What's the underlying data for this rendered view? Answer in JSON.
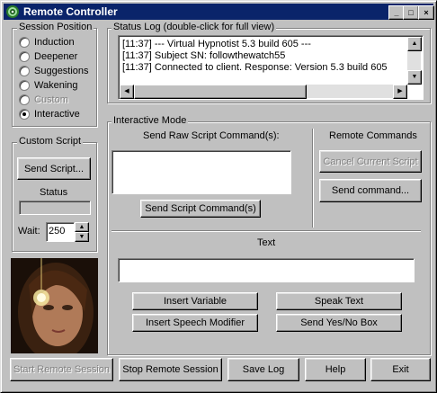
{
  "window": {
    "title": "Remote Controller",
    "controls": [
      "_",
      "□",
      "×"
    ]
  },
  "session_position": {
    "label": "Session Position",
    "options": [
      {
        "label": "Induction",
        "checked": false,
        "enabled": true
      },
      {
        "label": "Deepener",
        "checked": false,
        "enabled": true
      },
      {
        "label": "Suggestions",
        "checked": false,
        "enabled": true
      },
      {
        "label": "Wakening",
        "checked": false,
        "enabled": true
      },
      {
        "label": "Custom",
        "checked": false,
        "enabled": false
      },
      {
        "label": "Interactive",
        "checked": true,
        "enabled": true
      }
    ]
  },
  "custom_script": {
    "label": "Custom Script",
    "send_button": "Send Script...",
    "status_label": "Status",
    "wait_label": "Wait:",
    "wait_value": "250"
  },
  "status_log": {
    "label": "Status Log (double-click for full view)",
    "lines": [
      "[11:37] --- Virtual Hypnotist 5.3 build 605 ---",
      "[11:37] Subject SN: followthewatch55",
      "[11:37] Connected to client. Response:  Version 5.3 build 605"
    ]
  },
  "interactive_mode": {
    "label": "Interactive Mode",
    "raw_label": "Send Raw Script Command(s):",
    "raw_value": "",
    "send_script_button": "Send Script Command(s)",
    "remote_label": "Remote Commands",
    "cancel_button": "Cancel Current Script",
    "send_command_button": "Send command...",
    "text_label": "Text",
    "text_value": "",
    "insert_variable_button": "Insert Variable",
    "speak_text_button": "Speak Text",
    "insert_speech_button": "Insert Speech Modifier",
    "yes_no_button": "Send Yes/No Box"
  },
  "footer": {
    "start_button": "Start Remote Session",
    "stop_button": "Stop Remote Session",
    "save_log_button": "Save Log",
    "help_button": "Help",
    "exit_button": "Exit"
  }
}
